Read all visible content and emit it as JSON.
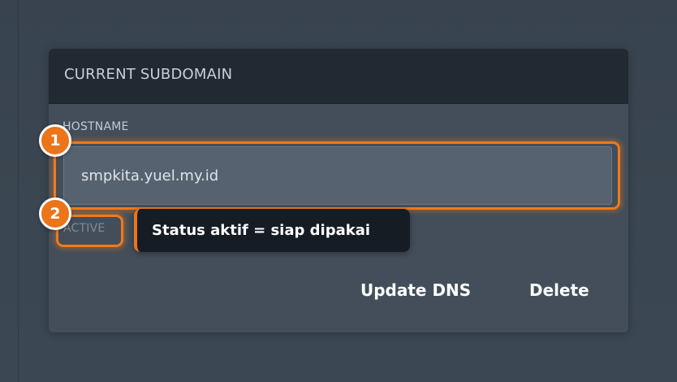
{
  "card": {
    "title": "CURRENT SUBDOMAIN",
    "hostname_label": "HOSTNAME",
    "hostname_value": "smpkita.yuel.my.id",
    "status": "ACTIVE",
    "update_label": "Update DNS",
    "delete_label": "Delete"
  },
  "annotations": {
    "marker_1": "1",
    "marker_2": "2",
    "tooltip": "Status aktif = siap dipakai"
  },
  "colors": {
    "accent": "#ec7419",
    "card_header": "#212a33",
    "card_body": "#434e5a",
    "input_bg": "#566270",
    "tooltip_bg": "#151c24"
  }
}
